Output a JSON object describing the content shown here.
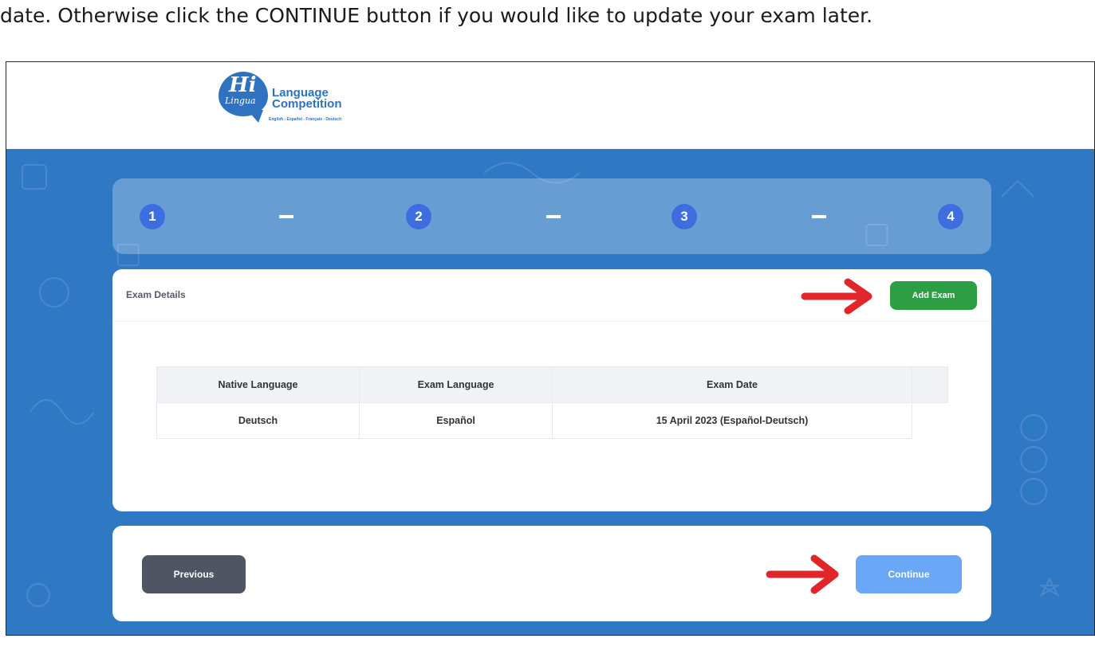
{
  "caption": "date. Otherwise click the CONTINUE button if you would like to update your exam later.",
  "logo": {
    "hi": "Hi",
    "lingua": "Lingua",
    "line1": "Language",
    "line2": "Competition",
    "languages": "English - Español - Français - Deutsch"
  },
  "stepper": {
    "steps": [
      "1",
      "2",
      "3",
      "4"
    ],
    "dash": "–"
  },
  "exam_card": {
    "title": "Exam Details",
    "add_button": "Add Exam",
    "table": {
      "headers": [
        "Native Language",
        "Exam Language",
        "Exam Date"
      ],
      "rows": [
        [
          "Deutsch",
          "Español",
          "15 April 2023 (Español-Deutsch)"
        ]
      ]
    }
  },
  "nav": {
    "previous": "Previous",
    "continue": "Continue"
  },
  "colors": {
    "page_blue": "#2f78c4",
    "step_circle": "#3e6de0",
    "add_button": "#2e9e45",
    "previous_button": "#4f5562",
    "continue_button": "#6aa7f7",
    "annotation_arrow": "#e0262a"
  }
}
